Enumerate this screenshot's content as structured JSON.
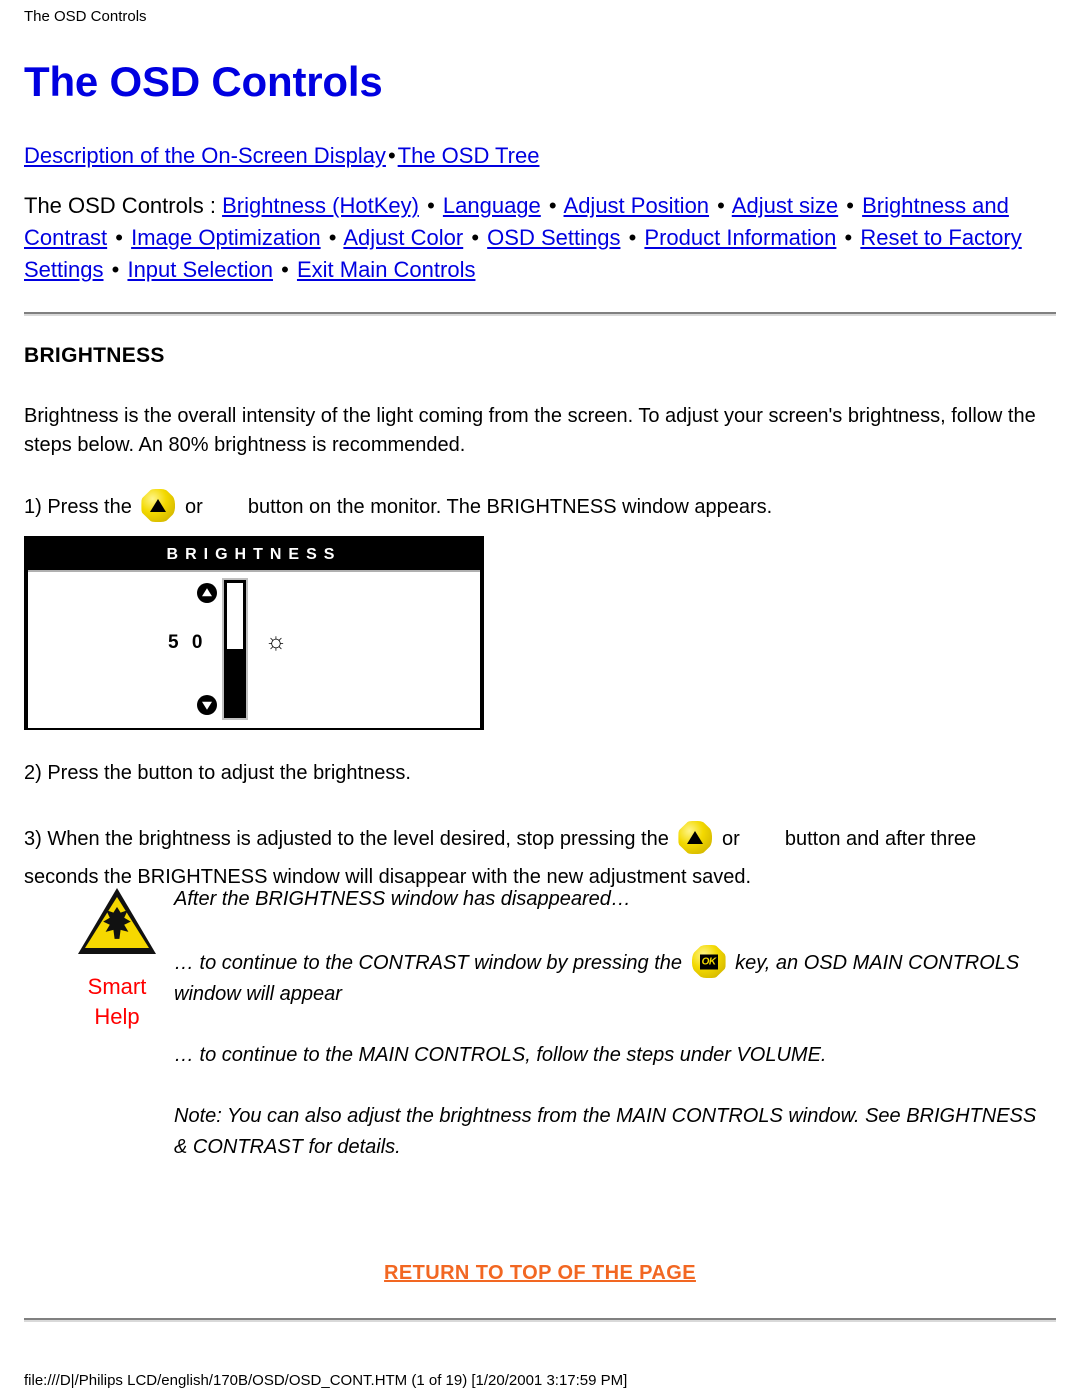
{
  "header": {
    "breadcrumb": "The OSD Controls"
  },
  "main": {
    "title": "The OSD Controls",
    "nav_row1": {
      "links": [
        {
          "label": "Description of the On-Screen Display"
        },
        {
          "label": "The OSD Tree"
        }
      ],
      "separator": "•"
    },
    "nav_row2": {
      "lead": "The OSD Controls : ",
      "separator": "•",
      "links": [
        {
          "label": "Brightness (HotKey)"
        },
        {
          "label": "Language"
        },
        {
          "label": "Adjust Position"
        },
        {
          "label": "Adjust size"
        },
        {
          "label": "Brightness and Contrast"
        },
        {
          "label": "Image Optimization"
        },
        {
          "label": "Adjust Color"
        },
        {
          "label": "OSD Settings"
        },
        {
          "label": "Product Information"
        },
        {
          "label": "Reset to Factory Settings"
        },
        {
          "label": "Input Selection"
        },
        {
          "label": "Exit Main Controls"
        }
      ]
    },
    "section_heading": "BRIGHTNESS",
    "intro": "Brightness is the overall intensity of the light coming from the screen. To adjust your screen's brightness, follow the steps below. An 80% brightness is recommended.",
    "step1_before": "1) Press the",
    "step1_mid": "or",
    "step1_after": "button on the monitor. The BRIGHTNESS window appears.",
    "step2": "2) Press the button to adjust the brightness.",
    "step3_before": "3) When the brightness is adjusted to the level desired, stop pressing the",
    "step3_mid": "or",
    "step3_after": "button and after three seconds the BRIGHTNESS window will disappear with the new adjustment saved."
  },
  "osd_window": {
    "title": "BRIGHTNESS",
    "value": "5 0",
    "fill_percent": 50,
    "up_icon": "triangle-up-icon",
    "down_icon": "triangle-down-icon",
    "brightness_icon": "☼"
  },
  "smart_help": {
    "icon": "warning-triangle-icon",
    "label_line1": "Smart",
    "label_line2": "Help",
    "label_color": "#ff0000",
    "paragraphs": [
      "After the BRIGHTNESS window has disappeared…",
      "… to continue to the CONTRAST window by pressing the",
      "key, an OSD MAIN CONTROLS window will appear",
      "… to continue to the MAIN CONTROLS, follow the steps under VOLUME.",
      "Note: You can also adjust the brightness from the MAIN CONTROLS window. See BRIGHTNESS & CONTRAST for details."
    ]
  },
  "footer": {
    "return_link": "RETURN TO TOP OF THE PAGE",
    "return_link_color": "#f26722",
    "file_path": "file:///D|/Philips LCD/english/170B/OSD/OSD_CONT.HTM (1 of 19) [1/20/2001 3:17:59 PM]"
  }
}
